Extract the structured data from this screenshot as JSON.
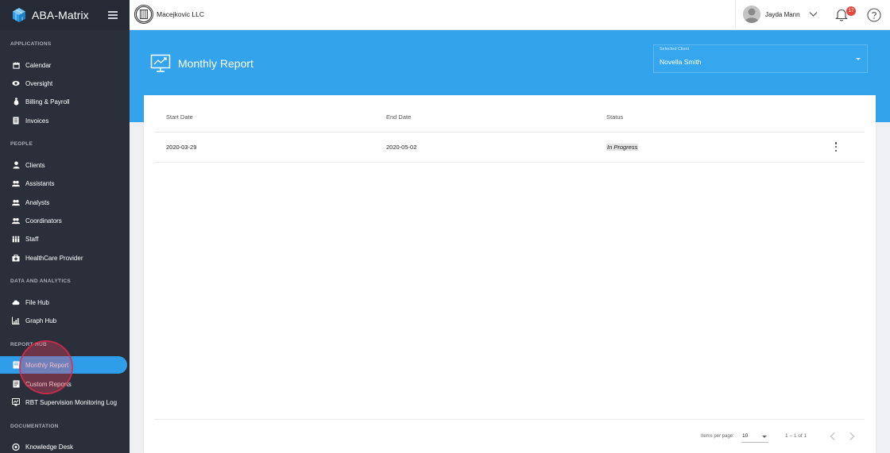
{
  "app": {
    "name": "ABA-Matrix"
  },
  "topbar": {
    "company": "Macejkovic LLC",
    "user_name": "Jayda Mann",
    "notification_count": "17"
  },
  "sidebar": {
    "sections": [
      {
        "title": "APPLICATIONS",
        "items": [
          {
            "label": "Calendar",
            "icon": "calendar-icon"
          },
          {
            "label": "Oversight",
            "icon": "eye-icon"
          },
          {
            "label": "Billing & Payroll",
            "icon": "money-bag-icon"
          },
          {
            "label": "Invoices",
            "icon": "invoice-icon"
          }
        ]
      },
      {
        "title": "PEOPLE",
        "items": [
          {
            "label": "Clients",
            "icon": "user-icon"
          },
          {
            "label": "Assistants",
            "icon": "users-icon"
          },
          {
            "label": "Analysts",
            "icon": "users-icon"
          },
          {
            "label": "Coordinators",
            "icon": "users-icon"
          },
          {
            "label": "Staff",
            "icon": "staff-icon"
          },
          {
            "label": "HealthCare Provider",
            "icon": "medical-bag-icon"
          }
        ]
      },
      {
        "title": "DATA AND ANALYTICS",
        "items": [
          {
            "label": "File Hub",
            "icon": "cloud-icon"
          },
          {
            "label": "Graph Hub",
            "icon": "chart-icon"
          }
        ]
      },
      {
        "title": "REPORT HUB",
        "items": [
          {
            "label": "Monthly Report",
            "icon": "report-icon",
            "active": true
          },
          {
            "label": "Custom Reports",
            "icon": "document-icon"
          },
          {
            "label": "RBT Supervision Monitoring Log",
            "icon": "monitor-icon"
          }
        ]
      },
      {
        "title": "DOCUMENTATION",
        "items": [
          {
            "label": "Knowledge Desk",
            "icon": "knowledge-icon"
          }
        ]
      }
    ]
  },
  "header": {
    "title": "Monthly Report",
    "client_select_label": "Selected Client",
    "client_select_value": "Novella Smith"
  },
  "table": {
    "columns": [
      "Start Date",
      "End Date",
      "Status"
    ],
    "rows": [
      {
        "start": "2020-03-29",
        "end": "2020-05-02",
        "status": "In Progress"
      }
    ]
  },
  "paginator": {
    "items_per_page_label": "Items per page:",
    "items_per_page": "10",
    "range": "1 – 1 of 1"
  },
  "colors": {
    "accent": "#33a3ec",
    "sidebar_bg": "#2b2f3a",
    "badge": "#e44a3d"
  }
}
